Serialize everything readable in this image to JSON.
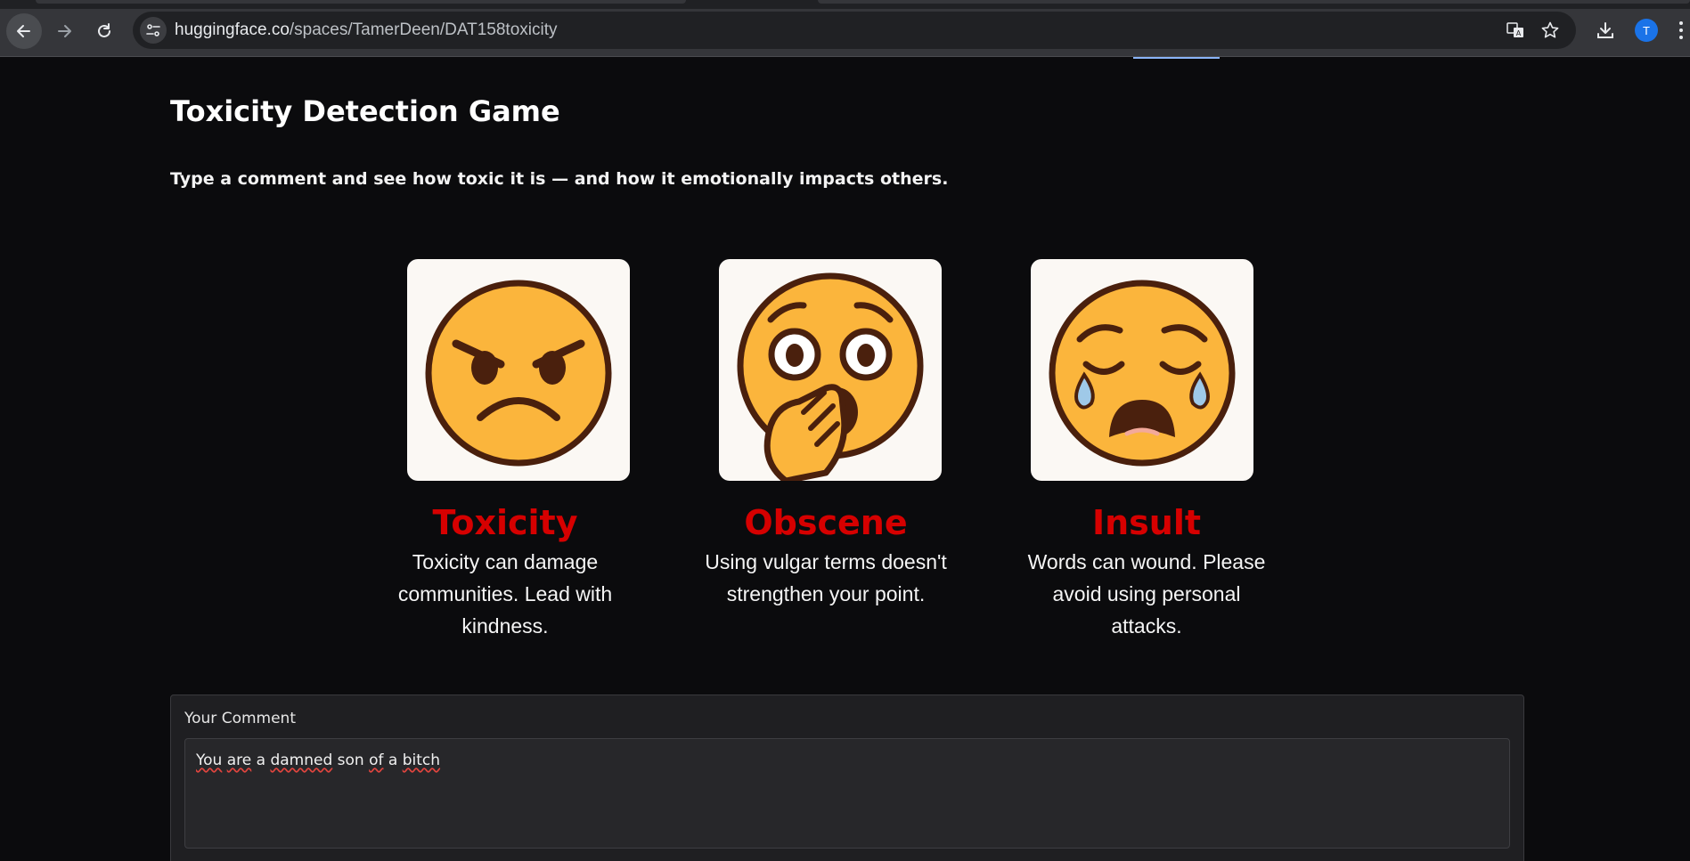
{
  "browser": {
    "url_host": "huggingface.co",
    "url_path": "/spaces/TamerDeen/DAT158toxicity",
    "avatar_letter": "T"
  },
  "page": {
    "title": "Toxicity Detection Game",
    "subtitle": "Type a comment and see how toxic it is — and how it emotionally impacts others."
  },
  "cards": [
    {
      "title": "Toxicity",
      "desc": "Toxicity can damage communities. Lead with kindness.",
      "icon": "angry-face-icon"
    },
    {
      "title": "Obscene",
      "desc": "Using vulgar terms doesn't strengthen your point.",
      "icon": "shocked-face-icon"
    },
    {
      "title": "Insult",
      "desc": "Words can wound. Please avoid using personal attacks.",
      "icon": "crying-face-icon"
    }
  ],
  "comment": {
    "label": "Your Comment",
    "words": [
      "You",
      "are",
      "a",
      "damned",
      "son",
      "of",
      "a",
      "bitch"
    ]
  },
  "colors": {
    "accent_red": "#d60000",
    "emoji_yellow": "#fbb53c",
    "emoji_outline": "#4a200d",
    "background": "#0b0b0d"
  }
}
